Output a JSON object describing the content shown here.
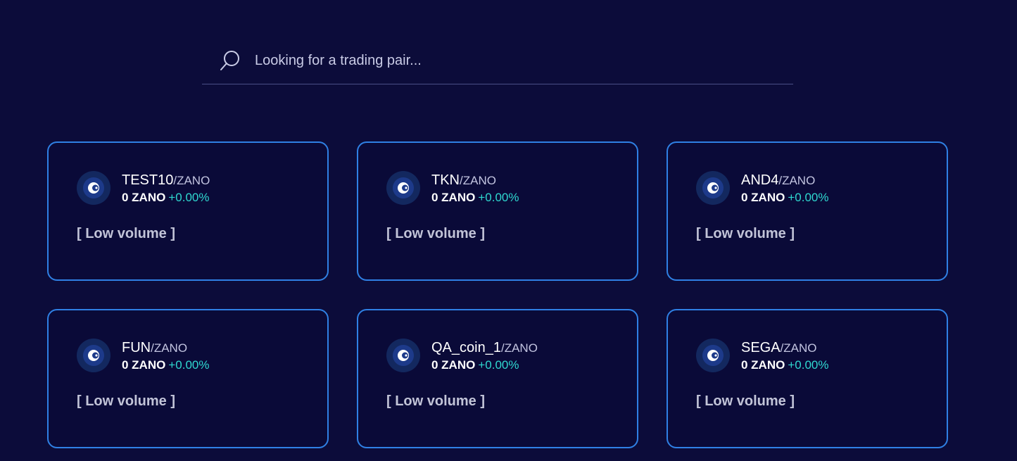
{
  "search": {
    "placeholder": "Looking for a trading pair...",
    "icon": "search-icon"
  },
  "colors": {
    "background": "#0c0c3a",
    "card_border": "#2f80e4",
    "change_positive": "#2fd8d0"
  },
  "pairs": [
    {
      "base": "TEST10",
      "quote": "/ZANO",
      "price": "0 ZANO",
      "change": "+0.00%",
      "volume": "[ Low volume ]",
      "icon": "zano-coin-icon"
    },
    {
      "base": "TKN",
      "quote": "/ZANO",
      "price": "0 ZANO",
      "change": "+0.00%",
      "volume": "[ Low volume ]",
      "icon": "zano-coin-icon"
    },
    {
      "base": "AND4",
      "quote": "/ZANO",
      "price": "0 ZANO",
      "change": "+0.00%",
      "volume": "[ Low volume ]",
      "icon": "zano-coin-icon"
    },
    {
      "base": "FUN",
      "quote": "/ZANO",
      "price": "0 ZANO",
      "change": "+0.00%",
      "volume": "[ Low volume ]",
      "icon": "zano-coin-icon"
    },
    {
      "base": "QA_coin_1",
      "quote": "/ZANO",
      "price": "0 ZANO",
      "change": "+0.00%",
      "volume": "[ Low volume ]",
      "icon": "zano-coin-icon"
    },
    {
      "base": "SEGA",
      "quote": "/ZANO",
      "price": "0 ZANO",
      "change": "+0.00%",
      "volume": "[ Low volume ]",
      "icon": "zano-coin-icon"
    }
  ]
}
